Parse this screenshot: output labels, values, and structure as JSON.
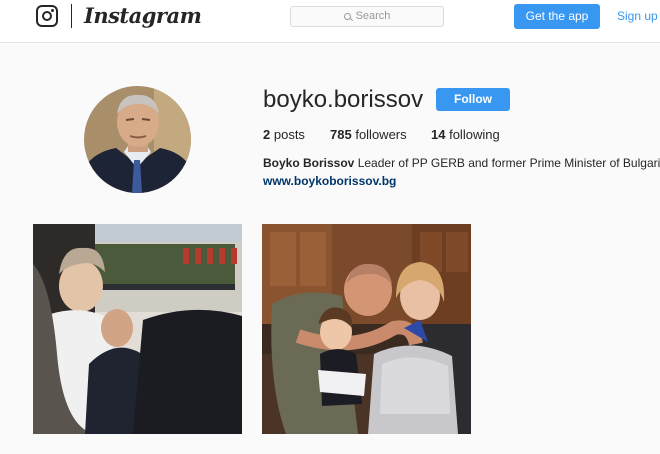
{
  "nav": {
    "logo_icon": "instagram-camera-icon",
    "wordmark": "Instagram",
    "search_placeholder": "Search",
    "get_app_label": "Get the app",
    "signup_label": "Sign up",
    "accent_color": "#3897f0"
  },
  "profile": {
    "username": "boyko.borissov",
    "follow_label": "Follow",
    "posts_count": "2",
    "posts_label": "posts",
    "followers_count": "785",
    "followers_label": "followers",
    "following_count": "14",
    "following_label": "following",
    "full_name": "Boyko Borissov",
    "bio": "Leader of PP GERB and former Prime Minister of Bulgaria",
    "website": "www.boykoborissov.bg"
  },
  "posts": [
    {
      "icon": "photo-ceremony"
    },
    {
      "icon": "photo-family"
    }
  ]
}
